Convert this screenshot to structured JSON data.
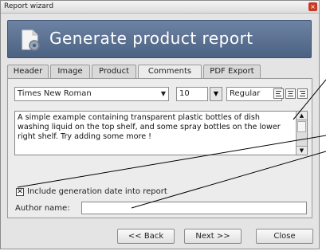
{
  "window": {
    "title": "Report wizard",
    "close_glyph": "×"
  },
  "banner": {
    "heading": "Generate product report",
    "icon": "document-gear-icon"
  },
  "tabs": [
    {
      "label": "Header",
      "active": false
    },
    {
      "label": "Image",
      "active": false
    },
    {
      "label": "Product",
      "active": false
    },
    {
      "label": "Comments",
      "active": true
    },
    {
      "label": "PDF Export",
      "active": false
    }
  ],
  "toolbar": {
    "font_family": "Times New Roman",
    "font_size": "10",
    "font_style": "Regular",
    "alignments": [
      "align-left-icon",
      "align-center-icon",
      "align-right-icon",
      "align-justify-icon"
    ]
  },
  "comments": {
    "text": "A simple example containing transparent plastic bottles of dish washing liquid on the top shelf, and some spray bottles on the lower right shelf. Try adding some more !"
  },
  "options": {
    "include_date_label": "Include generation date into report",
    "include_date_checked": true
  },
  "author": {
    "label": "Author name:",
    "value": ""
  },
  "buttons": {
    "back": "<< Back",
    "next": "Next >>",
    "close": "Close"
  },
  "colors": {
    "banner": "#5a7193",
    "close": "#c83a22",
    "callout_line": "#000000"
  }
}
